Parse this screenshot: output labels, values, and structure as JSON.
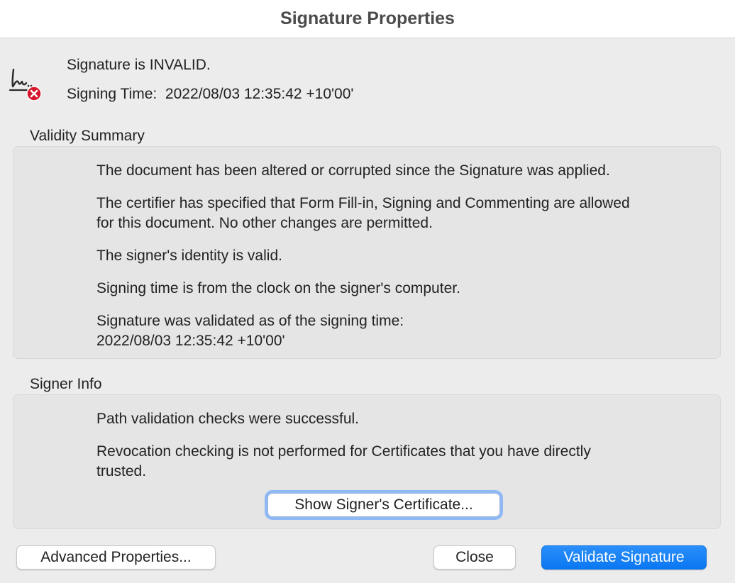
{
  "window": {
    "title": "Signature Properties"
  },
  "status": {
    "icon": "signature-invalid-icon",
    "validity": "Signature is INVALID.",
    "signing_time_label": "Signing Time:",
    "signing_time_value": "2022/08/03 12:35:42 +10'00'"
  },
  "validity_summary": {
    "heading": "Validity Summary",
    "lines": [
      "The document has been altered or corrupted since the Signature was applied.",
      "The certifier has specified that Form Fill-in, Signing and Commenting are allowed",
      "for this document. No other changes are permitted.",
      "The signer's identity is valid.",
      "Signing time is from the clock on the signer's computer.",
      "Signature was validated as of the signing time:",
      "2022/08/03 12:35:42 +10'00'"
    ]
  },
  "signer_info": {
    "heading": "Signer Info",
    "lines": [
      "Path validation checks were successful.",
      "Revocation checking is not performed for Certificates that you have directly",
      "trusted."
    ],
    "show_certificate_label": "Show Signer's Certificate..."
  },
  "buttons": {
    "advanced_label": "Advanced Properties...",
    "close_label": "Close",
    "validate_label": "Validate Signature"
  },
  "colors": {
    "primary": "#0a77f2",
    "error": "#d6162c",
    "focus_ring": "#8fb9f6"
  }
}
